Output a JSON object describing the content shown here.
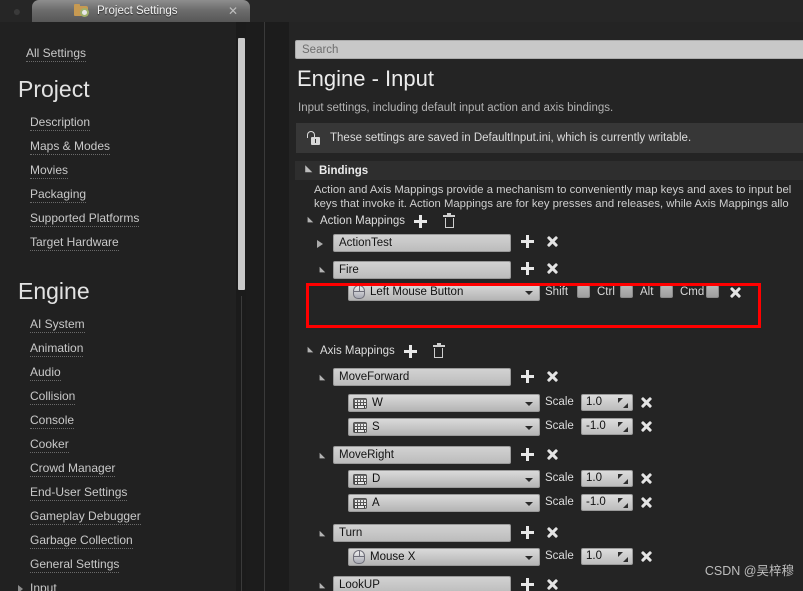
{
  "window": {
    "tab_title": "Project Settings",
    "tab_icon": "folder-gear-icon",
    "close_icon": "close-icon"
  },
  "sidebar": {
    "all_settings": "All Settings",
    "sections": [
      {
        "heading": "Project",
        "items": [
          "Description",
          "Maps & Modes",
          "Movies",
          "Packaging",
          "Supported Platforms",
          "Target Hardware"
        ]
      },
      {
        "heading": "Engine",
        "items": [
          "AI System",
          "Animation",
          "Audio",
          "Collision",
          "Console",
          "Cooker",
          "Crowd Manager",
          "End-User Settings",
          "Gameplay Debugger",
          "Garbage Collection",
          "General Settings",
          "Input"
        ]
      }
    ]
  },
  "search": {
    "placeholder": "Search",
    "value": ""
  },
  "page": {
    "title": "Engine - Input",
    "subtitle": "Input settings, including default input action and axis bindings.",
    "notice": "These settings are saved in DefaultInput.ini, which is currently writable.",
    "notice_icon": "unlocked-padlock-icon"
  },
  "bindings": {
    "category_label": "Bindings",
    "description_line1": "Action and Axis Mappings provide a mechanism to conveniently map keys and axes to input bel",
    "description_line2": "keys that invoke it. Action Mappings are for key presses and releases, while Axis Mappings allo",
    "action_mappings": {
      "label": "Action Mappings",
      "add_icon": "plus-icon",
      "delete_icon": "trash-icon",
      "rows": [
        {
          "name": "ActionTest",
          "expanded": false,
          "keys": []
        },
        {
          "name": "Fire",
          "expanded": true,
          "highlighted": true,
          "keys": [
            {
              "key": "Left Mouse Button",
              "device_icon": "mouse-icon",
              "modifiers": [
                {
                  "label": "Shift",
                  "checked": false
                },
                {
                  "label": "Ctrl",
                  "checked": false
                },
                {
                  "label": "Alt",
                  "checked": false
                },
                {
                  "label": "Cmd",
                  "checked": false
                }
              ]
            }
          ]
        }
      ]
    },
    "axis_mappings": {
      "label": "Axis Mappings",
      "add_icon": "plus-icon",
      "delete_icon": "trash-icon",
      "scale_label": "Scale",
      "rows": [
        {
          "name": "MoveForward",
          "expanded": true,
          "keys": [
            {
              "key": "W",
              "device_icon": "keyboard-icon",
              "scale": "1.0"
            },
            {
              "key": "S",
              "device_icon": "keyboard-icon",
              "scale": "-1.0"
            }
          ]
        },
        {
          "name": "MoveRight",
          "expanded": true,
          "keys": [
            {
              "key": "D",
              "device_icon": "keyboard-icon",
              "scale": "1.0"
            },
            {
              "key": "A",
              "device_icon": "keyboard-icon",
              "scale": "-1.0"
            }
          ]
        },
        {
          "name": "Turn",
          "expanded": true,
          "keys": [
            {
              "key": "Mouse X",
              "device_icon": "mouse-icon",
              "scale": "1.0"
            }
          ]
        },
        {
          "name": "LookUP",
          "expanded": true,
          "keys": []
        }
      ]
    }
  },
  "highlight": {
    "color": "#ff0000"
  },
  "watermark": "CSDN @吴梓穆"
}
